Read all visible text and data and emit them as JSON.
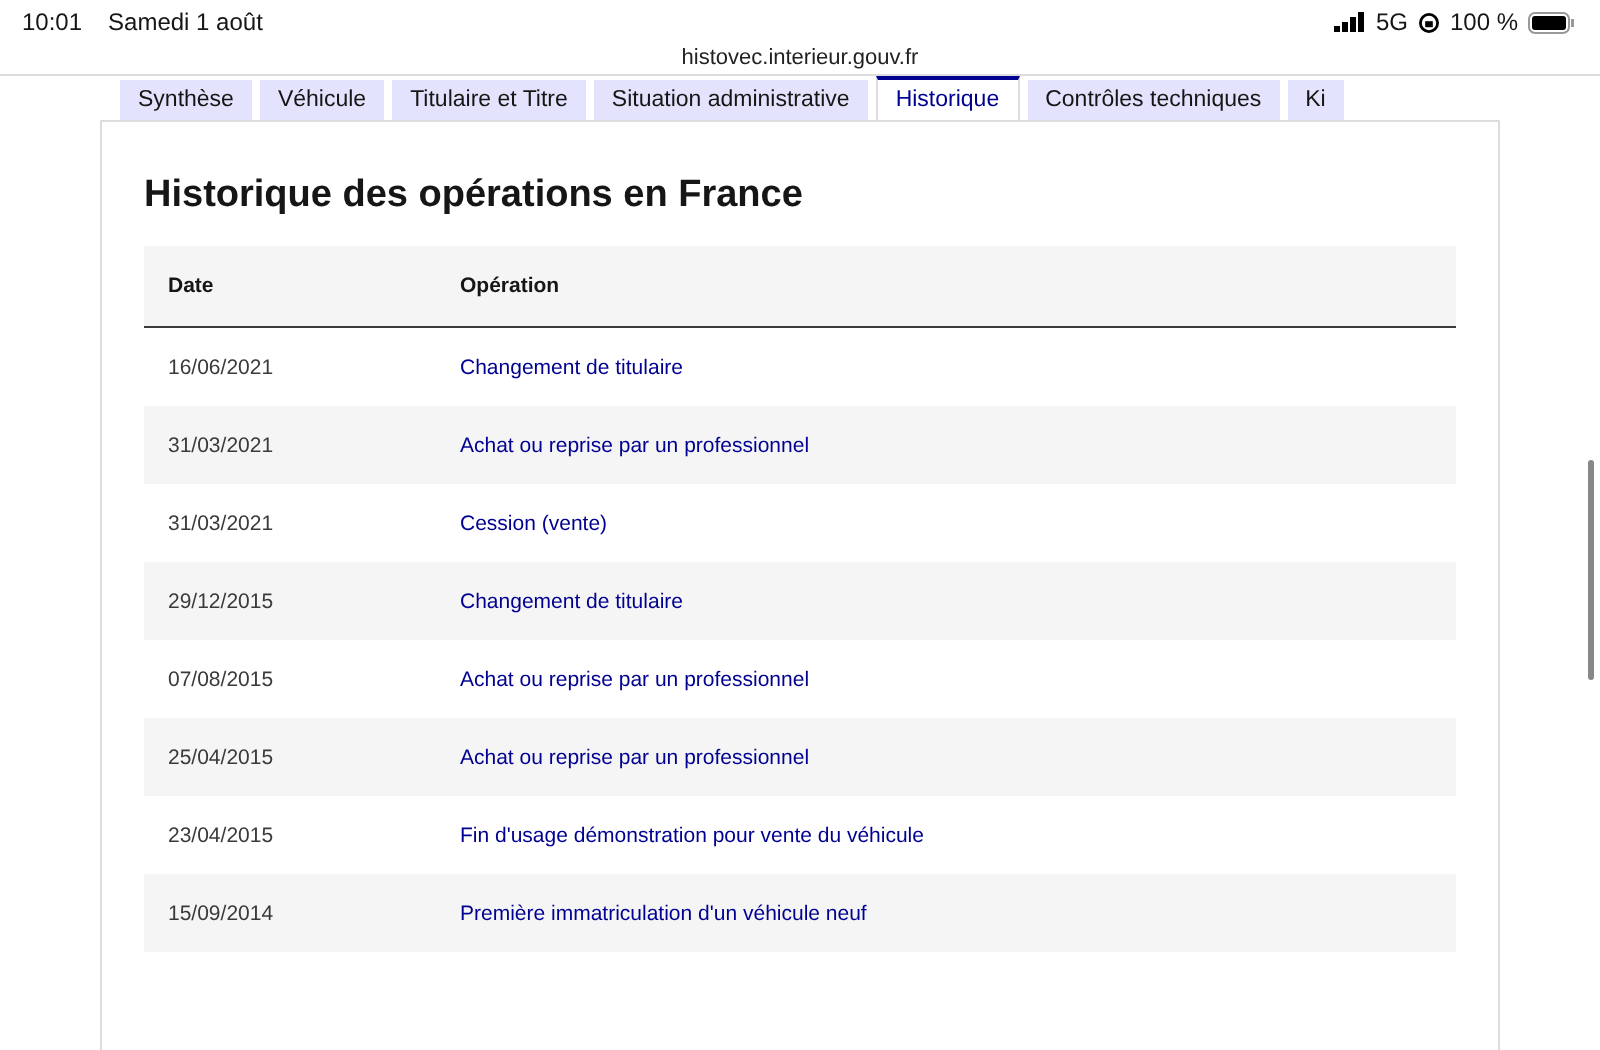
{
  "status_bar": {
    "time": "10:01",
    "date": "Samedi 1 août",
    "network": "5G",
    "battery": "100 %"
  },
  "address_bar": {
    "url": "histovec.interieur.gouv.fr"
  },
  "tabs": [
    {
      "label": "Synthèse",
      "selected": false
    },
    {
      "label": "Véhicule",
      "selected": false
    },
    {
      "label": "Titulaire et Titre",
      "selected": false
    },
    {
      "label": "Situation administrative",
      "selected": false
    },
    {
      "label": "Historique",
      "selected": true
    },
    {
      "label": "Contrôles techniques",
      "selected": false
    },
    {
      "label": "Ki",
      "selected": false
    }
  ],
  "title": "Historique des opérations en France",
  "table": {
    "columns": [
      "Date",
      "Opération"
    ],
    "rows": [
      [
        "16/06/2021",
        "Changement de titulaire"
      ],
      [
        "31/03/2021",
        "Achat ou reprise par un professionnel"
      ],
      [
        "31/03/2021",
        "Cession (vente)"
      ],
      [
        "29/12/2015",
        "Changement de titulaire"
      ],
      [
        "07/08/2015",
        "Achat ou reprise par un professionnel"
      ],
      [
        "25/04/2015",
        "Achat ou reprise par un professionnel"
      ],
      [
        "23/04/2015",
        "Fin d'usage démonstration pour vente du véhicule"
      ],
      [
        "15/09/2014",
        "Première immatriculation d'un véhicule neuf"
      ]
    ]
  }
}
